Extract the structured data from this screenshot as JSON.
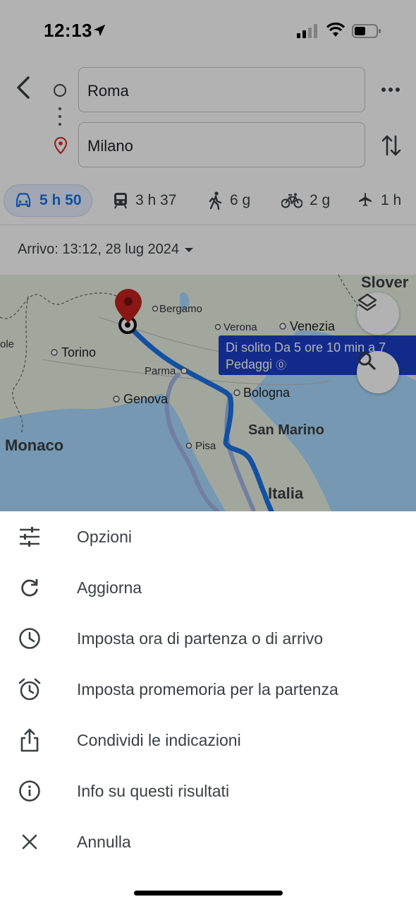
{
  "status": {
    "time": "12:13"
  },
  "search": {
    "origin": "Roma",
    "destination": "Milano"
  },
  "modes": [
    {
      "name": "car",
      "label": "5 h 50",
      "active": true
    },
    {
      "name": "transit",
      "label": "3 h 37",
      "active": false
    },
    {
      "name": "walk",
      "label": "6 g",
      "active": false
    },
    {
      "name": "bike",
      "label": "2 g",
      "active": false
    },
    {
      "name": "flight",
      "label": "1 h",
      "active": false
    }
  ],
  "arrival": {
    "label": "Arrivo: 13:12, 28 lug 2024"
  },
  "map": {
    "labels": {
      "slovenia": "Slover",
      "bergamo": "Bergamo",
      "verona": "Verona",
      "venezia": "Venezia",
      "ole": "ole",
      "torino": "Torino",
      "parma": "Parma",
      "bologna": "Bologna",
      "genova": "Genova",
      "san_marino": "San Marino",
      "monaco": "Monaco",
      "pisa": "Pisa",
      "italia": "Italia"
    },
    "callout": {
      "line1": "Di solito Da 5 ore 10 min a 7",
      "line2": "Pedaggi"
    },
    "route_color": "#1a73e8",
    "callout_color": "#1a3ec8"
  },
  "menu": [
    {
      "icon": "tune-icon",
      "label": "Opzioni"
    },
    {
      "icon": "refresh-icon",
      "label": "Aggiorna"
    },
    {
      "icon": "clock-icon",
      "label": "Imposta ora di partenza o di arrivo"
    },
    {
      "icon": "alarm-icon",
      "label": "Imposta promemoria per la partenza"
    },
    {
      "icon": "share-icon",
      "label": "Condividi le indicazioni"
    },
    {
      "icon": "info-icon",
      "label": "Info su questi risultati"
    },
    {
      "icon": "close-icon",
      "label": "Annulla"
    }
  ]
}
